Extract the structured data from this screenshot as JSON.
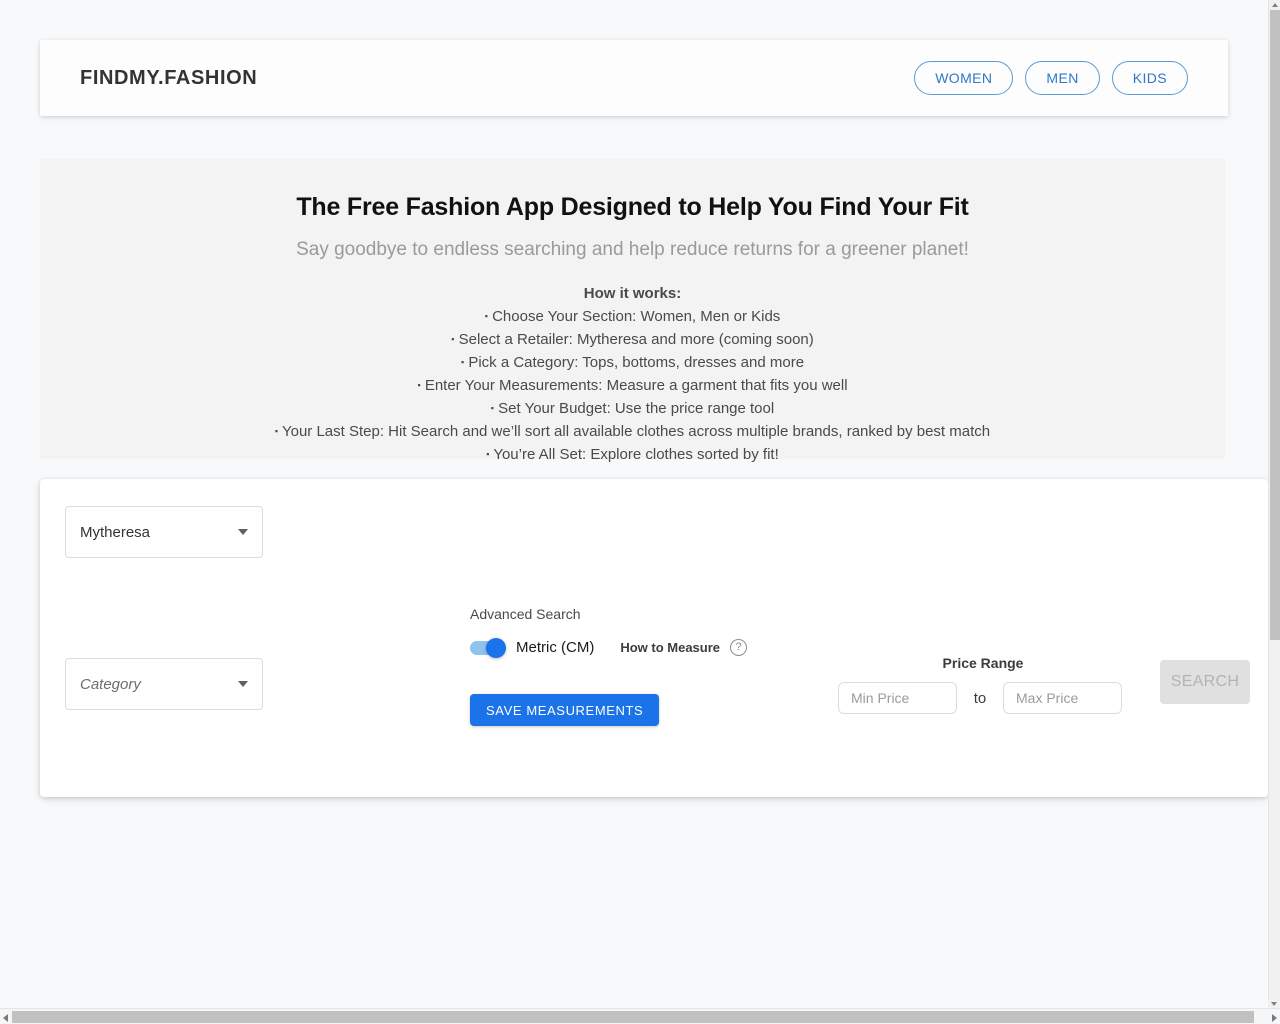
{
  "header": {
    "logo": "FINDMY.FASHION",
    "nav": [
      {
        "label": "WOMEN"
      },
      {
        "label": "MEN"
      },
      {
        "label": "KIDS"
      }
    ]
  },
  "hero": {
    "title": "The Free Fashion App Designed to Help You Find Your Fit",
    "subtitle": "Say goodbye to endless searching and help reduce returns for a greener planet!",
    "how_it_works_title": "How it works:",
    "steps": [
      "Choose Your Section: Women, Men or Kids",
      "Select a Retailer: Mytheresa and more (coming soon)",
      "Pick a Category: Tops, bottoms, dresses and more",
      "Enter Your Measurements: Measure a garment that fits you well",
      "Set Your Budget: Use the price range tool",
      "Your Last Step: Hit Search and we’ll sort all available clothes across multiple brands, ranked by best match",
      "You’re All Set: Explore clothes sorted by fit!"
    ],
    "bullet_glyph": "▪"
  },
  "form": {
    "retailer_select": {
      "value": "Mytheresa"
    },
    "category_select": {
      "placeholder": "Category"
    },
    "advanced_search_label": "Advanced Search",
    "unit_toggle": {
      "label": "Metric (CM)",
      "state": "on"
    },
    "how_to_measure": {
      "label": "How to Measure",
      "icon": "?"
    },
    "save_button": "SAVE MEASUREMENTS",
    "price_range": {
      "title": "Price Range",
      "min_placeholder": "Min Price",
      "min_value": "",
      "separator": "to",
      "max_placeholder": "Max Price",
      "max_value": ""
    },
    "search_button": "SEARCH"
  },
  "colors": {
    "accent_blue": "#1a73e8",
    "nav_blue": "#2e78c7",
    "page_bg": "#f7f9fb",
    "hero_bg": "#f3f3f3",
    "disabled_bg": "#e0e0e0"
  }
}
